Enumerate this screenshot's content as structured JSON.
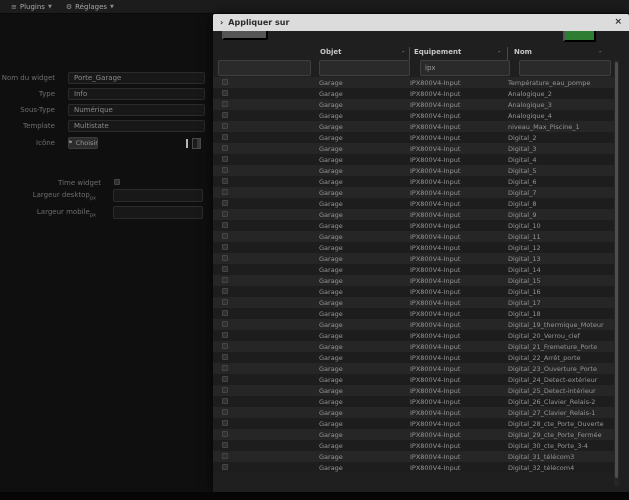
{
  "menubar": {
    "plugins_label": "Plugins",
    "reglages_label": "Réglages"
  },
  "form": {
    "fields": [
      {
        "label": "Nom du widget",
        "value": "Porte_Garage"
      },
      {
        "label": "Type",
        "value": "Info"
      },
      {
        "label": "Sous-Type",
        "value": "Numérique"
      },
      {
        "label": "Template",
        "value": "Multistate"
      }
    ],
    "icone_label": "Icône",
    "choisir_label": "Choisir",
    "time_widget_label": "Time widget",
    "largeur_desktop_label": "Largeur desktop",
    "largeur_mobile_label": "Largeur mobile",
    "px_suffix": "px",
    "largeur_desktop_value": "",
    "largeur_mobile_value": ""
  },
  "modal": {
    "title": "Appliquer sur",
    "close_glyph": "×",
    "accent_green": "#2e7d33",
    "table": {
      "columns": [
        "Objet",
        "Equipement",
        "Nom"
      ],
      "sort_char": "-",
      "filters": {
        "select_filter": "",
        "objet_filter": "",
        "equipement_filter": "ipx",
        "nom_filter": ""
      },
      "rows": [
        {
          "objet": "Garage",
          "equipement": "IPX800V4-Input",
          "nom": "Température_eau_pompe"
        },
        {
          "objet": "Garage",
          "equipement": "IPX800V4-Input",
          "nom": "Analogique_2"
        },
        {
          "objet": "Garage",
          "equipement": "IPX800V4-Input",
          "nom": "Analogique_3"
        },
        {
          "objet": "Garage",
          "equipement": "IPX800V4-Input",
          "nom": "Analogique_4"
        },
        {
          "objet": "Garage",
          "equipement": "IPX800V4-Input",
          "nom": "niveau_Max_Piscine_1"
        },
        {
          "objet": "Garage",
          "equipement": "IPX800V4-Input",
          "nom": "Digital_2"
        },
        {
          "objet": "Garage",
          "equipement": "IPX800V4-Input",
          "nom": "Digital_3"
        },
        {
          "objet": "Garage",
          "equipement": "IPX800V4-Input",
          "nom": "Digital_4"
        },
        {
          "objet": "Garage",
          "equipement": "IPX800V4-Input",
          "nom": "Digital_5"
        },
        {
          "objet": "Garage",
          "equipement": "IPX800V4-Input",
          "nom": "Digital_6"
        },
        {
          "objet": "Garage",
          "equipement": "IPX800V4-Input",
          "nom": "Digital_7"
        },
        {
          "objet": "Garage",
          "equipement": "IPX800V4-Input",
          "nom": "Digital_8"
        },
        {
          "objet": "Garage",
          "equipement": "IPX800V4-Input",
          "nom": "Digital_9"
        },
        {
          "objet": "Garage",
          "equipement": "IPX800V4-Input",
          "nom": "Digital_10"
        },
        {
          "objet": "Garage",
          "equipement": "IPX800V4-Input",
          "nom": "Digital_11"
        },
        {
          "objet": "Garage",
          "equipement": "IPX800V4-Input",
          "nom": "Digital_12"
        },
        {
          "objet": "Garage",
          "equipement": "IPX800V4-Input",
          "nom": "Digital_13"
        },
        {
          "objet": "Garage",
          "equipement": "IPX800V4-Input",
          "nom": "Digital_14"
        },
        {
          "objet": "Garage",
          "equipement": "IPX800V4-Input",
          "nom": "Digital_15"
        },
        {
          "objet": "Garage",
          "equipement": "IPX800V4-Input",
          "nom": "Digital_16"
        },
        {
          "objet": "Garage",
          "equipement": "IPX800V4-Input",
          "nom": "Digital_17"
        },
        {
          "objet": "Garage",
          "equipement": "IPX800V4-Input",
          "nom": "Digital_18"
        },
        {
          "objet": "Garage",
          "equipement": "IPX800V4-Input",
          "nom": "Digital_19_thermique_Moteur"
        },
        {
          "objet": "Garage",
          "equipement": "IPX800V4-Input",
          "nom": "Digital_20_Verrou_clef"
        },
        {
          "objet": "Garage",
          "equipement": "IPX800V4-Input",
          "nom": "Digital_21_Fremeture_Porte"
        },
        {
          "objet": "Garage",
          "equipement": "IPX800V4-Input",
          "nom": "Digital_22_Arrêt_porte"
        },
        {
          "objet": "Garage",
          "equipement": "IPX800V4-Input",
          "nom": "Digital_23_Ouverture_Porte"
        },
        {
          "objet": "Garage",
          "equipement": "IPX800V4-Input",
          "nom": "Digital_24_Detect-extérieur"
        },
        {
          "objet": "Garage",
          "equipement": "IPX800V4-Input",
          "nom": "Digital_25_Detect-intérieur"
        },
        {
          "objet": "Garage",
          "equipement": "IPX800V4-Input",
          "nom": "Digital_26_Clavier_Relais-2"
        },
        {
          "objet": "Garage",
          "equipement": "IPX800V4-Input",
          "nom": "Digital_27_Clavier_Relais-1"
        },
        {
          "objet": "Garage",
          "equipement": "IPX800V4-Input",
          "nom": "Digital_28_cte_Porte_Ouverte"
        },
        {
          "objet": "Garage",
          "equipement": "IPX800V4-Input",
          "nom": "Digital_29_cte_Porte_Fermée"
        },
        {
          "objet": "Garage",
          "equipement": "IPX800V4-Input",
          "nom": "Digital_30_cte_Porte_3-4"
        },
        {
          "objet": "Garage",
          "equipement": "IPX800V4-Input",
          "nom": "Digital_31_télécom3"
        },
        {
          "objet": "Garage",
          "equipement": "IPX800V4-Input",
          "nom": "Digital_32_télécom4"
        }
      ]
    }
  }
}
